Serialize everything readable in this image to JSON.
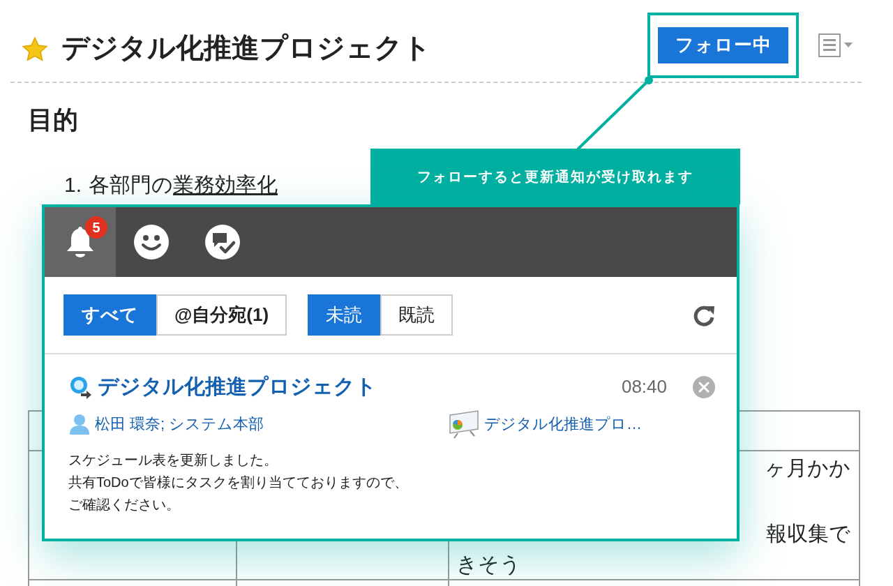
{
  "page": {
    "title": "デジタル化推進プロジェクト",
    "starred": true,
    "follow_button": "フォロー中",
    "section_heading": "目的",
    "list_items": [
      {
        "number": "1.",
        "text": "各部門の",
        "link": "業務効率化"
      }
    ],
    "table": {
      "rows": [
        {
          "column_3": [
            "ヶ月かか",
            "報収集で",
            "きそう"
          ]
        }
      ]
    }
  },
  "callout": {
    "text": "フォローすると更新通知が受け取れます"
  },
  "notification_panel": {
    "tabs": [
      {
        "kind": "bell",
        "badge": "5",
        "selected": true
      },
      {
        "kind": "smiley",
        "selected": false
      },
      {
        "kind": "chat-check",
        "selected": false
      }
    ],
    "filters": [
      [
        {
          "label": "すべて",
          "selected": true
        },
        {
          "label": "@自分宛(1)",
          "selected": false
        }
      ],
      [
        {
          "label": "未読",
          "selected": true
        },
        {
          "label": "既読",
          "selected": false
        }
      ]
    ],
    "items": [
      {
        "title": "デジタル化推進プロジェクト",
        "time": "08:40",
        "sender": "松田 環奈; システム本部",
        "space": "デジタル化推進プロ…",
        "body": [
          "スケジュール表を更新しました。",
          "共有ToDoで皆様にタスクを割り当てておりますので、",
          "ご確認ください。"
        ]
      }
    ]
  }
}
